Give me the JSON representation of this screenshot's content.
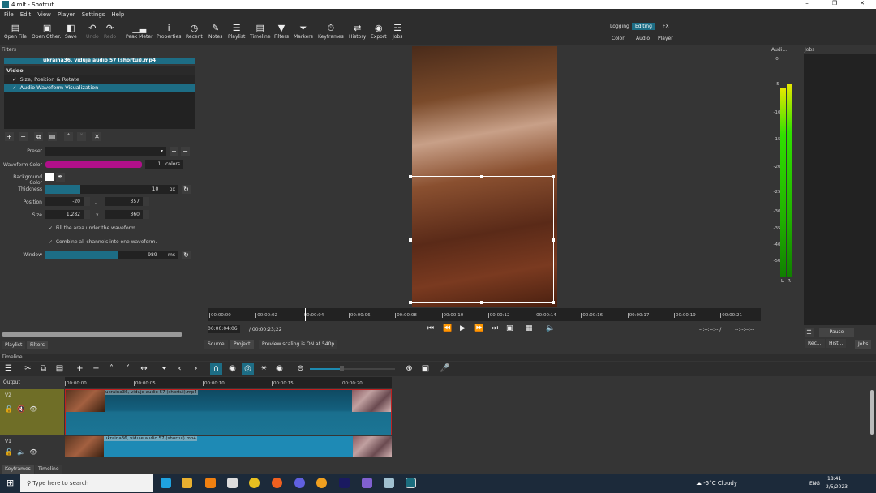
{
  "window": {
    "title": "4.mlt - Shotcut"
  },
  "menu": [
    "File",
    "Edit",
    "View",
    "Player",
    "Settings",
    "Help"
  ],
  "toolbar": [
    {
      "label": "Open File",
      "icon": "folder-icon",
      "enabled": true
    },
    {
      "label": "Open Other..",
      "icon": "open-other-icon",
      "enabled": true
    },
    {
      "label": "Save",
      "icon": "save-icon",
      "enabled": true
    },
    {
      "label": "Undo",
      "icon": "undo-icon",
      "enabled": false
    },
    {
      "label": "Redo",
      "icon": "redo-icon",
      "enabled": false
    },
    {
      "label": "Peak Meter",
      "icon": "peak-meter-icon",
      "enabled": true
    },
    {
      "label": "Properties",
      "icon": "info-icon",
      "enabled": true
    },
    {
      "label": "Recent",
      "icon": "clock-icon",
      "enabled": true
    },
    {
      "label": "Notes",
      "icon": "notes-icon",
      "enabled": true
    },
    {
      "label": "Playlist",
      "icon": "list-icon",
      "enabled": true
    },
    {
      "label": "Timeline",
      "icon": "timeline-icon",
      "enabled": true
    },
    {
      "label": "Filters",
      "icon": "filter-icon",
      "enabled": true
    },
    {
      "label": "Markers",
      "icon": "marker-icon",
      "enabled": true
    },
    {
      "label": "Keyframes",
      "icon": "stopwatch-icon",
      "enabled": true
    },
    {
      "label": "History",
      "icon": "history-icon",
      "enabled": true
    },
    {
      "label": "Export",
      "icon": "export-icon",
      "enabled": true
    },
    {
      "label": "Jobs",
      "icon": "jobs-icon",
      "enabled": true
    }
  ],
  "layouts": {
    "row1": [
      "Logging",
      "Editing",
      "FX"
    ],
    "row2": [
      "Color",
      "Audio",
      "Player"
    ],
    "active": "Editing"
  },
  "filters": {
    "panel_title": "Filters",
    "clip_name": "ukraina36, viduje audio 57 (shortui).mp4",
    "group": "Video",
    "items": [
      {
        "label": "Size, Position & Rotate",
        "checked": true
      },
      {
        "label": "Audio Waveform Visualization",
        "checked": true,
        "selected": true
      }
    ],
    "preset_label": "Preset",
    "waveform_color_label": "Waveform Color",
    "waveform_color": "#b0108a",
    "colors_count": "1",
    "colors_unit": "colors",
    "bg_color_label": "Background Color",
    "bg_color": "#ffffff",
    "thickness_label": "Thickness",
    "thickness": "10",
    "thickness_unit": "px",
    "thickness_fraction": 0.26,
    "position_label": "Position",
    "pos_x": "-20",
    "pos_sep": ",",
    "pos_y": "357",
    "size_label": "Size",
    "size_w": "1,282",
    "size_sep": "x",
    "size_h": "360",
    "fill_label": "Fill the area under the waveform.",
    "fill_checked": true,
    "combine_label": "Combine all channels into one waveform.",
    "combine_checked": true,
    "window_label": "Window",
    "window": "989",
    "window_unit": "ms",
    "window_fraction": 0.54
  },
  "left_tabs": [
    "Playlist",
    "Filters"
  ],
  "player": {
    "ruler": [
      "00:00:00",
      "00:00:02",
      "00:00:04",
      "00:00:06",
      "00:00:08",
      "00:00:10",
      "00:00:12",
      "00:00:14",
      "00:00:16",
      "00:00:17",
      "00:00:19",
      "00:00:21"
    ],
    "current_time": "00:00:04;06",
    "duration": "/ 00:00:23;22",
    "in_point": "--:--:--:-- /",
    "out_point": "--:--:--:--",
    "tabs": [
      "Source",
      "Project"
    ],
    "status": "Preview scaling is ON at 540p"
  },
  "audio_meter": {
    "title": "Audi...",
    "ticks": [
      "0",
      "-5",
      "-10",
      "-15",
      "-20",
      "-25",
      "-30",
      "-35",
      "-40",
      "-50"
    ],
    "channels": [
      "L",
      "R"
    ],
    "levels_db": [
      -5.5,
      -4.8
    ],
    "peak_db": -3
  },
  "jobs": {
    "title": "Jobs",
    "pause": "Pause",
    "tabs": [
      "Rec...",
      "Hist...",
      "Jobs"
    ]
  },
  "timeline": {
    "title": "Timeline",
    "output": "Output",
    "ruler": [
      "00:00:00",
      "00:00:05",
      "00:00:10",
      "00:00:15",
      "00:00:20"
    ],
    "tracks": [
      {
        "name": "V2",
        "clip": "ukraina36, viduje audio 57 (shortui).mp4"
      },
      {
        "name": "V1",
        "clip": "ukraina36, viduje audio 57 (shortui).mp4"
      }
    ],
    "zoom_fraction": 0.35
  },
  "bottom_tabs": [
    "Keyframes",
    "Timeline"
  ],
  "taskbar": {
    "search_placeholder": "Type here to search",
    "weather": "-5°C  Cloudy",
    "lang": "ENG",
    "time": "18:41",
    "date": "2/5/2023"
  }
}
